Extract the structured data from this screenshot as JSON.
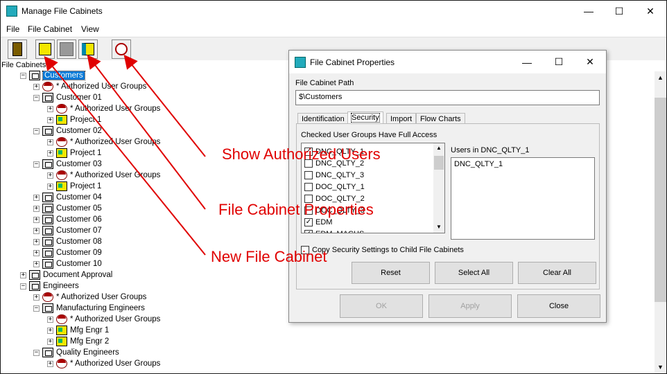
{
  "window": {
    "title": "Manage File Cabinets",
    "minimize": "—",
    "maximize": "☐",
    "close": "✕"
  },
  "menu": [
    "File",
    "File Cabinet",
    "View"
  ],
  "toolbar": {
    "buttons": [
      "open-door-icon",
      "new-file-cabinet-icon",
      "disabled-icon",
      "file-cabinet-properties-icon",
      "authorized-users-icon"
    ]
  },
  "tree": {
    "header": "File Cabinets",
    "nodes": [
      {
        "label": "Customers",
        "level": 1,
        "icon": "cabinet",
        "exp": "−",
        "selected": true
      },
      {
        "label": "* Authorized User Groups",
        "level": 2,
        "icon": "group",
        "exp": "+"
      },
      {
        "label": "Customer 01",
        "level": 2,
        "icon": "cabinet",
        "exp": "−"
      },
      {
        "label": "* Authorized User Groups",
        "level": 3,
        "icon": "group",
        "exp": "+"
      },
      {
        "label": "Project 1",
        "level": 3,
        "icon": "project",
        "exp": "+"
      },
      {
        "label": "Customer 02",
        "level": 2,
        "icon": "cabinet",
        "exp": "−"
      },
      {
        "label": "* Authorized User Groups",
        "level": 3,
        "icon": "group",
        "exp": "+"
      },
      {
        "label": "Project 1",
        "level": 3,
        "icon": "project",
        "exp": "+"
      },
      {
        "label": "Customer 03",
        "level": 2,
        "icon": "cabinet",
        "exp": "−"
      },
      {
        "label": "* Authorized User Groups",
        "level": 3,
        "icon": "group",
        "exp": "+"
      },
      {
        "label": "Project 1",
        "level": 3,
        "icon": "project",
        "exp": "+"
      },
      {
        "label": "Customer 04",
        "level": 2,
        "icon": "cabinet",
        "exp": "+"
      },
      {
        "label": "Customer 05",
        "level": 2,
        "icon": "cabinet",
        "exp": "+"
      },
      {
        "label": "Customer 06",
        "level": 2,
        "icon": "cabinet",
        "exp": "+"
      },
      {
        "label": "Customer 07",
        "level": 2,
        "icon": "cabinet",
        "exp": "+"
      },
      {
        "label": "Customer 08",
        "level": 2,
        "icon": "cabinet",
        "exp": "+"
      },
      {
        "label": "Customer 09",
        "level": 2,
        "icon": "cabinet",
        "exp": "+"
      },
      {
        "label": "Customer 10",
        "level": 2,
        "icon": "cabinet",
        "exp": "+"
      },
      {
        "label": "Document Approval",
        "level": 1,
        "icon": "cabinet",
        "exp": "+"
      },
      {
        "label": "Engineers",
        "level": 1,
        "icon": "cabinet",
        "exp": "−"
      },
      {
        "label": "* Authorized User Groups",
        "level": 2,
        "icon": "group",
        "exp": "+"
      },
      {
        "label": "Manufacturing Engineers",
        "level": 2,
        "icon": "cabinet",
        "exp": "−"
      },
      {
        "label": "* Authorized User Groups",
        "level": 3,
        "icon": "group",
        "exp": "+"
      },
      {
        "label": "Mfg Engr 1",
        "level": 3,
        "icon": "project",
        "exp": "+"
      },
      {
        "label": "Mfg Engr 2",
        "level": 3,
        "icon": "project",
        "exp": "+"
      },
      {
        "label": "Quality Engineers",
        "level": 2,
        "icon": "cabinet",
        "exp": "−"
      },
      {
        "label": "* Authorized User Groups",
        "level": 3,
        "icon": "group",
        "exp": "+"
      }
    ]
  },
  "callouts": {
    "show_authorized_users": "Show Authorized Users",
    "file_cabinet_properties": "File Cabinet Properties",
    "new_file_cabinet": "New File Cabinet",
    "color": "#e00000"
  },
  "dialog": {
    "title": "File Cabinet Properties",
    "path_label": "File Cabinet Path",
    "path_value": "$\\Customers",
    "tabs": [
      "Identification",
      "Security",
      "Import",
      "Flow Charts"
    ],
    "active_tab": "Security",
    "checked_groups_label": "Checked User Groups Have Full Access",
    "groups": [
      {
        "name": "DNC_QLTY_1",
        "checked": true
      },
      {
        "name": "DNC_QLTY_2",
        "checked": false
      },
      {
        "name": "DNC_QLTY_3",
        "checked": false
      },
      {
        "name": "DOC_QLTY_1",
        "checked": false
      },
      {
        "name": "DOC_QLTY_2",
        "checked": false
      },
      {
        "name": "DOC_QLTY_3",
        "checked": false
      },
      {
        "name": "EDM",
        "checked": true
      },
      {
        "name": "EDM_MACHS",
        "checked": true
      }
    ],
    "users_label": "Users in DNC_QLTY_1",
    "users": [
      "DNC_QLTY_1"
    ],
    "copy_settings_label": "Copy Security Settings to Child File Cabinets",
    "buttons": {
      "reset": "Reset",
      "select_all": "Select All",
      "clear_all": "Clear All",
      "ok": "OK",
      "apply": "Apply",
      "close": "Close"
    }
  }
}
